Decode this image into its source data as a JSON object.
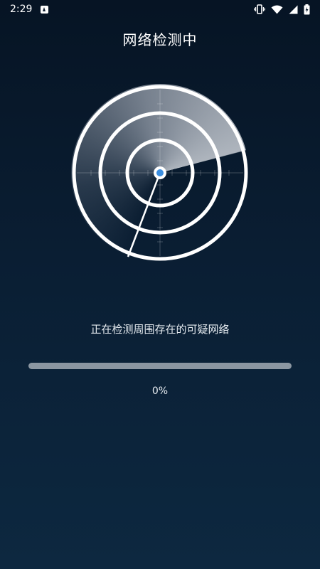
{
  "status_bar": {
    "time": "2:29",
    "icons": [
      "app-notice-icon",
      "vibrate-icon",
      "wifi-icon",
      "cell-signal-icon",
      "battery-icon"
    ]
  },
  "header": {
    "title": "网络检测中"
  },
  "scan": {
    "status_text": "正在检测周围存在的可疑网络",
    "progress_percent": 0,
    "progress_label": "0%"
  },
  "colors": {
    "background_top": "#061424",
    "background_bottom": "#0d2840",
    "ring": "#ffffff",
    "center_dot": "#3b8ee0",
    "progress_track": "#8b96a1"
  }
}
